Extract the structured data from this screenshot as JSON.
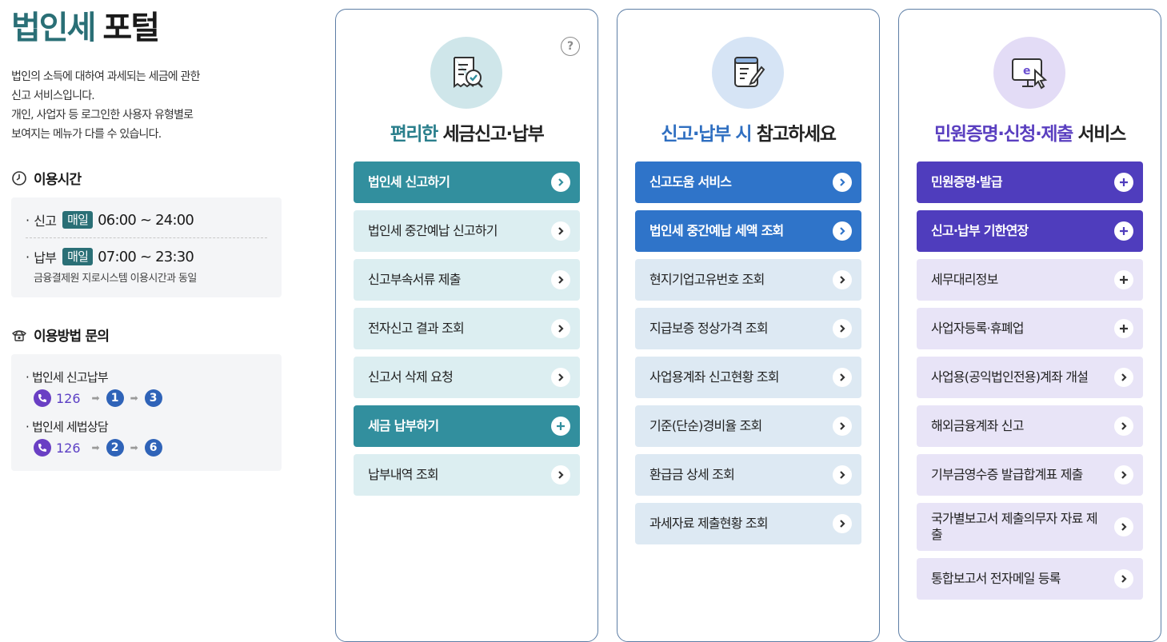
{
  "page": {
    "title_highlight": "법인세",
    "title_rest": "포털",
    "description": [
      "법인의 소득에 대하여 과세되는 세금에 관한",
      "신고 서비스입니다.",
      "개인, 사업자 등 로그인한 사용자 유형별로",
      "보여지는 메뉴가 다를 수 있습니다."
    ]
  },
  "hours": {
    "title": "이용시간",
    "filing": {
      "label": "신고",
      "badge": "매일",
      "time": "06:00 ~ 24:00"
    },
    "payment": {
      "label": "납부",
      "badge": "매일",
      "time": "07:00 ~ 23:30",
      "note": "금융결제원 지로시스템 이용시간과 동일"
    }
  },
  "contact": {
    "title": "이용방법 문의",
    "items": [
      {
        "label": "법인세 신고납부",
        "number": "126",
        "steps": [
          "1",
          "3"
        ]
      },
      {
        "label": "법인세 세법상담",
        "number": "126",
        "steps": [
          "2",
          "6"
        ]
      }
    ]
  },
  "colors": {
    "teal": "#328f9e",
    "teal_light": "#dceef1",
    "blue": "#2f74c9",
    "blue_light": "#dde9f3",
    "purple": "#4f3dbd",
    "purple_light": "#e8e4f7"
  },
  "columns": [
    {
      "title_highlight": "편리한",
      "title_rest": "세금신고·납부",
      "icon": "receipt-check-icon",
      "items": [
        {
          "label": "법인세 신고하기",
          "solid": true,
          "action": "chevron"
        },
        {
          "label": "법인세 중간예납 신고하기",
          "solid": false,
          "action": "chevron"
        },
        {
          "label": "신고부속서류 제출",
          "solid": false,
          "action": "chevron"
        },
        {
          "label": "전자신고 결과 조회",
          "solid": false,
          "action": "chevron"
        },
        {
          "label": "신고서 삭제 요청",
          "solid": false,
          "action": "chevron"
        },
        {
          "label": "세금 납부하기",
          "solid": true,
          "action": "plus"
        },
        {
          "label": "납부내역 조회",
          "solid": false,
          "action": "chevron"
        }
      ]
    },
    {
      "title_highlight": "신고·납부 시",
      "title_rest": "참고하세요",
      "icon": "note-pen-icon",
      "items": [
        {
          "label": "신고도움 서비스",
          "solid": true,
          "action": "chevron"
        },
        {
          "label": "법인세 중간예납 세액 조회",
          "solid": true,
          "action": "chevron"
        },
        {
          "label": "현지기업고유번호 조회",
          "solid": false,
          "action": "chevron"
        },
        {
          "label": "지급보증 정상가격 조회",
          "solid": false,
          "action": "chevron"
        },
        {
          "label": "사업용계좌 신고현황 조회",
          "solid": false,
          "action": "chevron"
        },
        {
          "label": "기준(단순)경비율 조회",
          "solid": false,
          "action": "chevron"
        },
        {
          "label": "환급금 상세 조회",
          "solid": false,
          "action": "chevron"
        },
        {
          "label": "과세자료 제출현황 조회",
          "solid": false,
          "action": "chevron"
        }
      ]
    },
    {
      "title_highlight": "민원증명·신청·제출",
      "title_rest": "서비스",
      "icon": "e-monitor-icon",
      "items": [
        {
          "label": "민원증명·발급",
          "solid": true,
          "action": "plus"
        },
        {
          "label": "신고·납부 기한연장",
          "solid": true,
          "action": "plus"
        },
        {
          "label": "세무대리정보",
          "solid": false,
          "action": "plus"
        },
        {
          "label": "사업자등록·휴폐업",
          "solid": false,
          "action": "plus"
        },
        {
          "label": "사업용(공익법인전용)계좌 개설",
          "solid": false,
          "action": "chevron"
        },
        {
          "label": "해외금융계좌 신고",
          "solid": false,
          "action": "chevron"
        },
        {
          "label": "기부금영수증 발급합계표 제출",
          "solid": false,
          "action": "chevron"
        },
        {
          "label": "국가별보고서 제출의무자 자료 제출",
          "solid": false,
          "action": "chevron",
          "tall": true
        },
        {
          "label": "통합보고서 전자메일 등록",
          "solid": false,
          "action": "chevron"
        }
      ]
    }
  ]
}
